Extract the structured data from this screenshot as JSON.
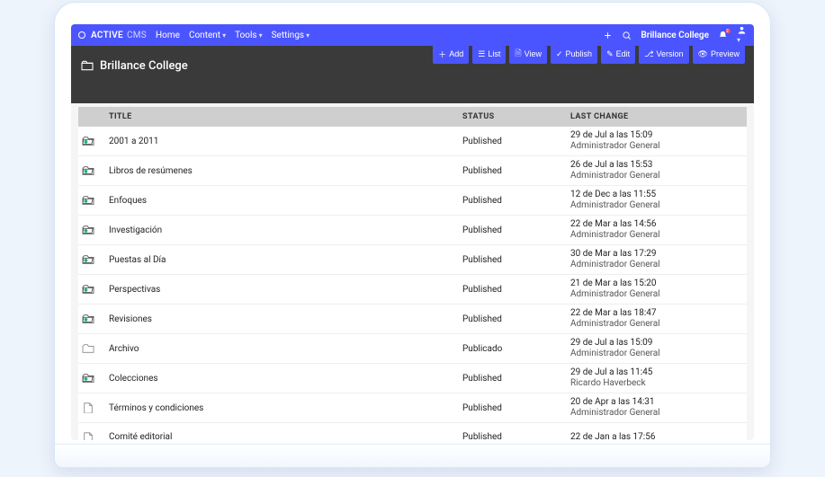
{
  "brand": {
    "name": "ACTIVE",
    "suffix": "CMS"
  },
  "menu": {
    "home": "Home",
    "content": "Content",
    "tools": "Tools",
    "settings": "Settings"
  },
  "org_name": "Brillance College",
  "notif_count": "2",
  "page": {
    "title": "Brillance College"
  },
  "toolbar": {
    "add": "Add",
    "list": "List",
    "view": "View",
    "publish": "Publish",
    "edit": "Edit",
    "version": "Version",
    "preview": "Preview"
  },
  "columns": {
    "title": "TITLE",
    "status": "STATUS",
    "last_change": "LAST CHANGE"
  },
  "rows": [
    {
      "icon": "folder-open-green",
      "title": "2001 a 2011",
      "status": "Published",
      "date": "29 de Jul a las 15:09",
      "user": "Administrador General"
    },
    {
      "icon": "folder-open-green",
      "title": "Libros de resúmenes",
      "status": "Published",
      "date": "26 de Jul a las 15:53",
      "user": "Administrador General"
    },
    {
      "icon": "folder-open-green",
      "title": "Enfoques",
      "status": "Published",
      "date": "12 de Dec a las 11:55",
      "user": "Administrador General"
    },
    {
      "icon": "folder-open-green",
      "title": "Investigación",
      "status": "Published",
      "date": "22 de Mar a las 14:56",
      "user": "Administrador General"
    },
    {
      "icon": "folder-open-green",
      "title": "Puestas al Día",
      "status": "Published",
      "date": "30 de Mar a las 17:29",
      "user": "Administrador General"
    },
    {
      "icon": "folder-open-green",
      "title": "Perspectivas",
      "status": "Published",
      "date": "21 de Mar a las 15:20",
      "user": "Administrador General"
    },
    {
      "icon": "folder-open-green",
      "title": "Revisiones",
      "status": "Published",
      "date": "22 de Mar a las 18:47",
      "user": "Administrador General"
    },
    {
      "icon": "folder-gray",
      "title": "Archivo",
      "status": "Publicado",
      "date": "29 de Jul a las 15:09",
      "user": "Administrador General"
    },
    {
      "icon": "folder-open-green",
      "title": "Colecciones",
      "status": "Published",
      "date": "29 de Jul a las 11:45",
      "user": "Ricardo Haverbeck"
    },
    {
      "icon": "page-gray",
      "title": "Términos y condiciones",
      "status": "Published",
      "date": "20 de Apr a las 14:31",
      "user": "Administrador General"
    },
    {
      "icon": "page-gray",
      "title": "Comité editorial",
      "status": "Published",
      "date": "22 de Jan a las 17:56",
      "user": ""
    }
  ]
}
